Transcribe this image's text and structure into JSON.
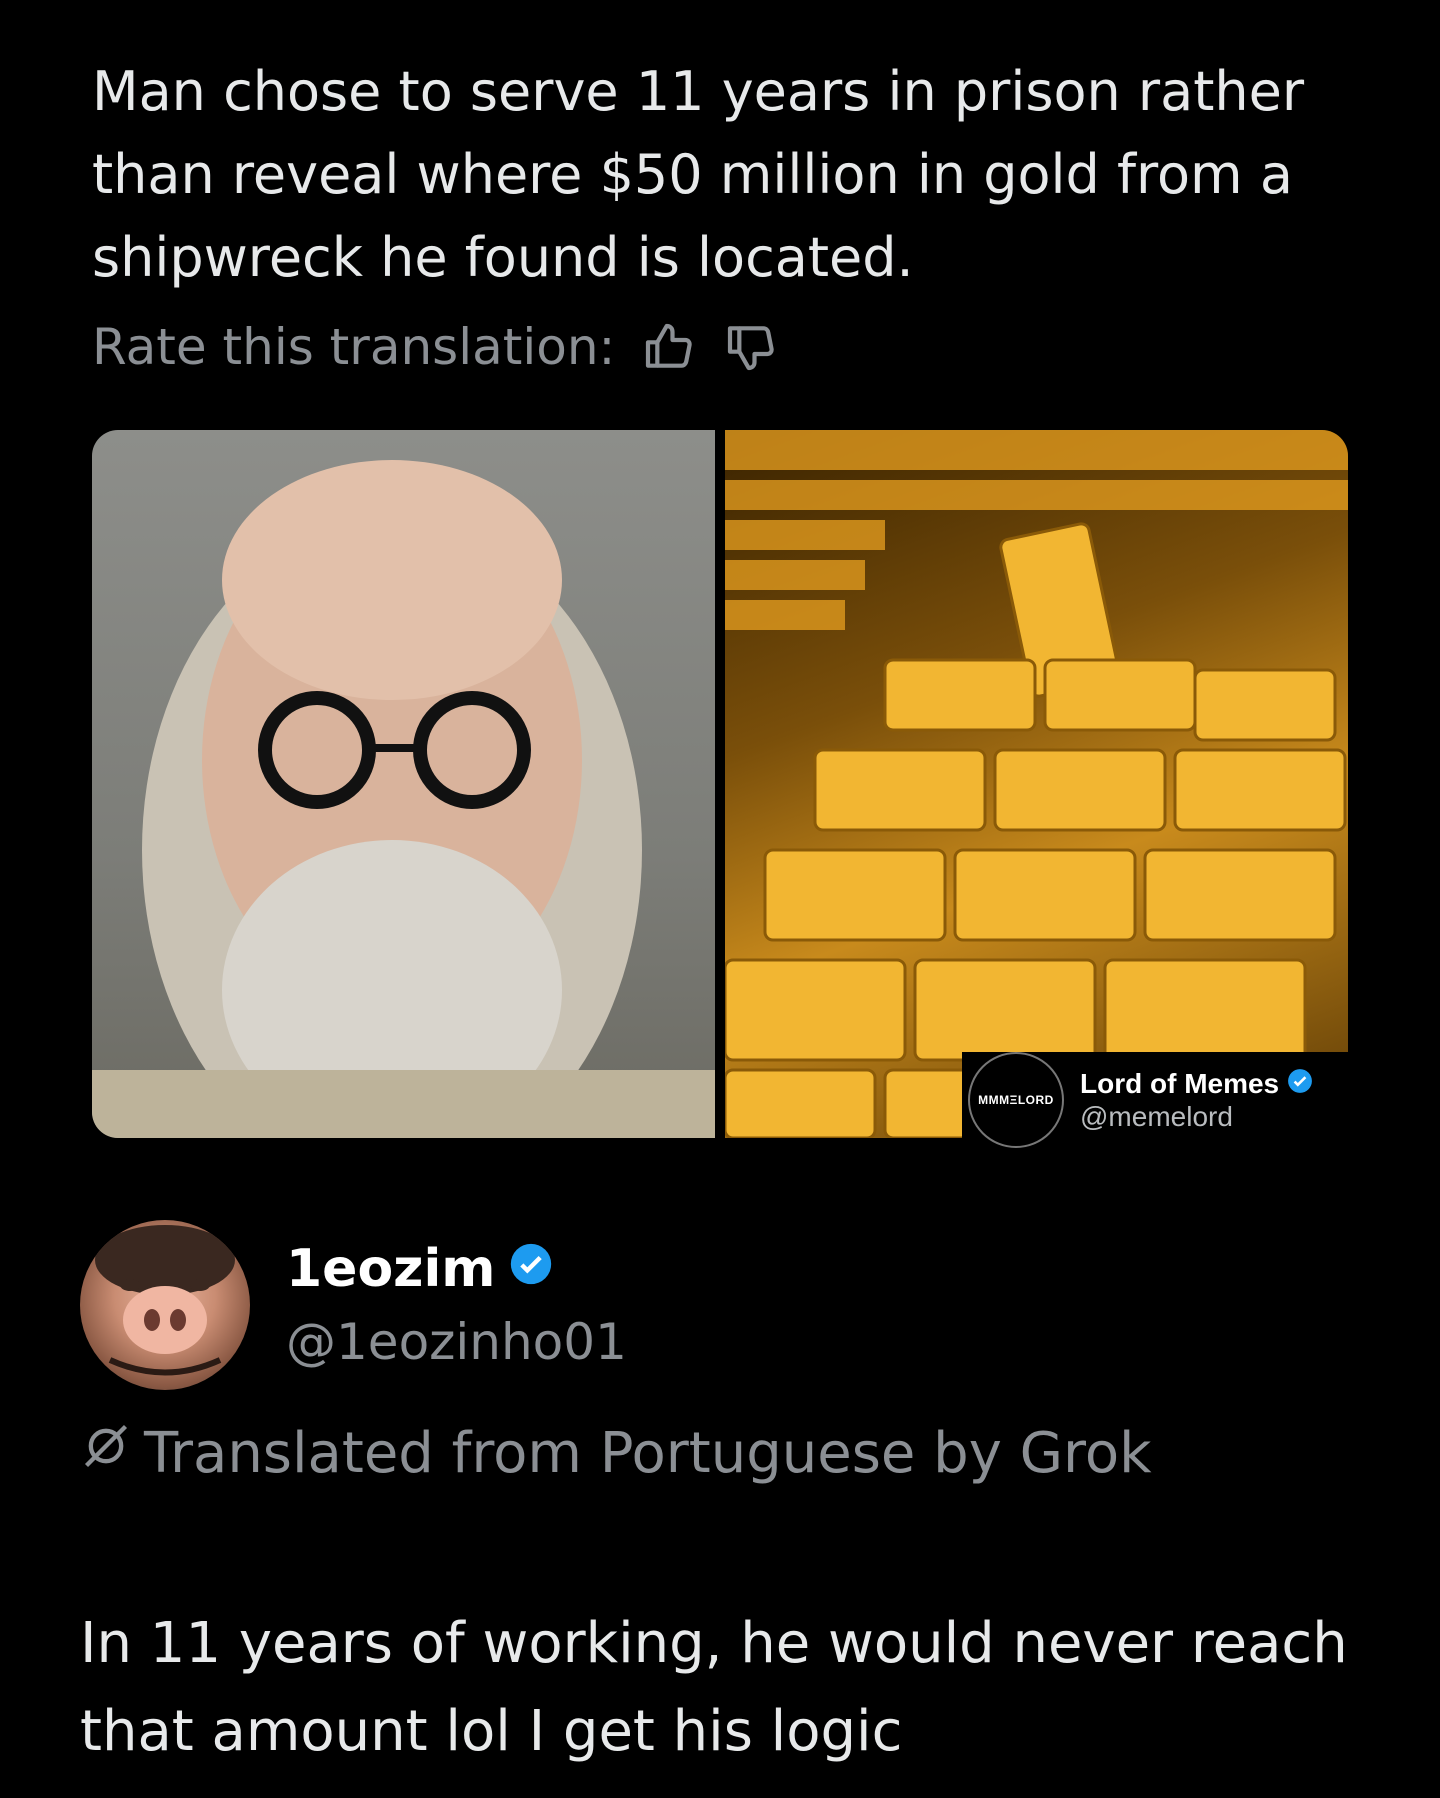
{
  "quoted_post": {
    "text": "Man chose to serve 11 years in prison rather than reveal where $50 million in gold from a shipwreck he found is located.",
    "rate_label": "Rate this translation:"
  },
  "watermark": {
    "logo_text": "MΜMΞLORD",
    "name": "Lord of Memes",
    "handle": "@memelord"
  },
  "author": {
    "name": "1eozim",
    "handle": "@1eozinho01"
  },
  "translation_note": "Translated from Portuguese by Grok",
  "reply_text": "In 11 years of working, he would never reach that amount lol I get his logic",
  "colors": {
    "background": "#000000",
    "text": "#e7e9ea",
    "muted": "#8b8f94",
    "verified": "#1d9bf0"
  }
}
